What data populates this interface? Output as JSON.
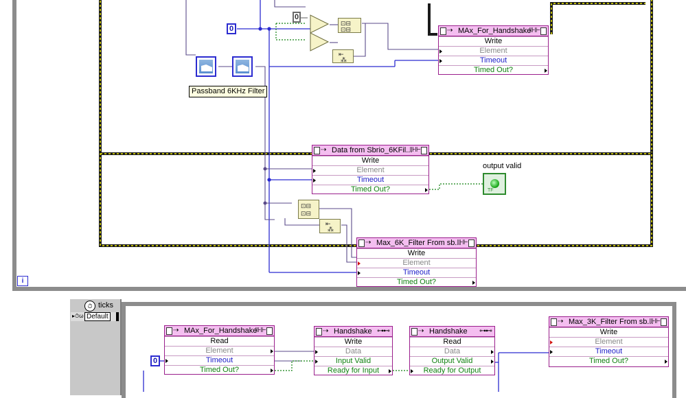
{
  "diagram": {
    "constants": {
      "zero_a": "0",
      "zero_b": "0",
      "zero_c": "0"
    },
    "tooltip": "Passband 6KHz Filter",
    "indicator_label": "output valid",
    "indicator_tf": "TF",
    "iteration_label": "i",
    "timed_loop": {
      "source_label": "ticks",
      "default_label": "Default"
    },
    "fifo_nodes": {
      "max_handshake_write": {
        "title": "MAx_For_Handshake",
        "rows": [
          "Write",
          "Element",
          "Timeout",
          "Timed Out?"
        ]
      },
      "data_from_sbrio": {
        "title": "Data from Sbrio_6KFil...",
        "rows": [
          "Write",
          "Element",
          "Timeout",
          "Timed Out?"
        ]
      },
      "max_6k_filter": {
        "title": "Max_6K_Filter From sb...",
        "rows": [
          "Write",
          "Element",
          "Timeout",
          "Timed Out?"
        ]
      },
      "max_handshake_read": {
        "title": "MAx_For_Handshake",
        "rows": [
          "Read",
          "Element",
          "Timeout",
          "Timed Out?"
        ]
      },
      "handshake_write": {
        "title": "Handshake",
        "rows": [
          "Write",
          "Data",
          "Input Valid",
          "Ready for Input"
        ]
      },
      "handshake_read": {
        "title": "Handshake",
        "rows": [
          "Read",
          "Data",
          "Output Valid",
          "Ready for Output"
        ]
      },
      "max_3k_filter": {
        "title": "Max_3K_Filter From sb...",
        "rows": [
          "Write",
          "Element",
          "Timeout",
          "Timed Out?"
        ]
      }
    },
    "colors": {
      "fifo_border": "#9a1e8c",
      "fifo_header": "#f4bef0",
      "wire_blue": "#2b2bd0",
      "wire_green": "#108010",
      "frame_yellow": "#f2ee00"
    }
  }
}
